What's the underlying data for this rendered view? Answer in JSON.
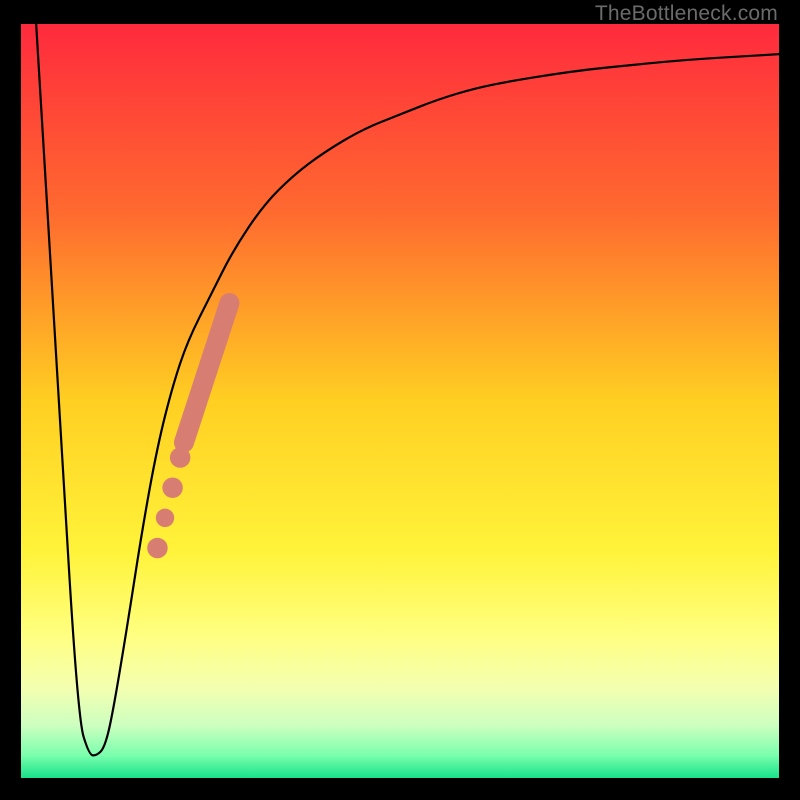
{
  "watermark": "TheBottleneck.com",
  "chart_data": {
    "type": "line",
    "title": "",
    "xlabel": "",
    "ylabel": "",
    "xlim": [
      0,
      100
    ],
    "ylim": [
      0,
      100
    ],
    "grid": false,
    "gradient_stops": [
      {
        "offset": 0.0,
        "color": "#ff2a3d"
      },
      {
        "offset": 0.25,
        "color": "#ff6a2f"
      },
      {
        "offset": 0.5,
        "color": "#ffcf22"
      },
      {
        "offset": 0.7,
        "color": "#fff33a"
      },
      {
        "offset": 0.81,
        "color": "#ffff80"
      },
      {
        "offset": 0.88,
        "color": "#f4ffb0"
      },
      {
        "offset": 0.93,
        "color": "#cdffc0"
      },
      {
        "offset": 0.97,
        "color": "#7affad"
      },
      {
        "offset": 1.0,
        "color": "#18e28a"
      }
    ],
    "series": [
      {
        "name": "bottleneck-curve",
        "x": [
          2,
          5,
          7.5,
          9,
          10,
          11,
          12,
          14,
          16,
          18,
          20,
          22,
          25,
          28,
          32,
          36,
          40,
          45,
          50,
          55,
          60,
          65,
          70,
          75,
          80,
          85,
          90,
          95,
          100
        ],
        "y": [
          100,
          50,
          8,
          3,
          3,
          4,
          8,
          20,
          33,
          44,
          52,
          58,
          64,
          70,
          76,
          80,
          83,
          86,
          88,
          90,
          91.5,
          92.5,
          93.3,
          94,
          94.5,
          95,
          95.4,
          95.7,
          96
        ]
      }
    ],
    "annotations": {
      "highlight_dots": [
        {
          "x": 18.0,
          "y": 30.5,
          "r": 1.5
        },
        {
          "x": 19.0,
          "y": 34.5,
          "r": 1.35
        },
        {
          "x": 20.0,
          "y": 38.5,
          "r": 1.5
        },
        {
          "x": 21.0,
          "y": 42.5,
          "r": 1.5
        }
      ],
      "highlight_band": {
        "x1": 21.5,
        "y1": 44.5,
        "x2": 27.5,
        "y2": 63.0
      },
      "highlight_color": "#d77d72"
    }
  }
}
